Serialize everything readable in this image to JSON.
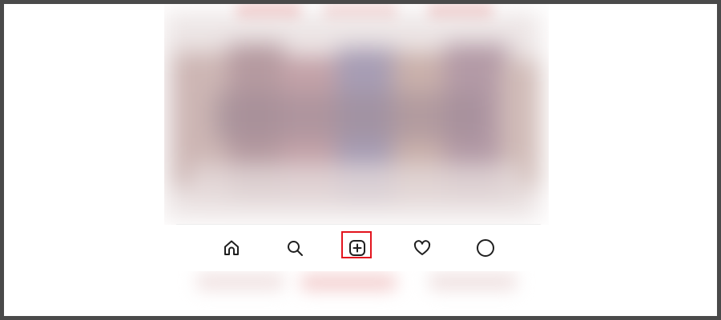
{
  "screen": {
    "frame_color": "#4a4a4a",
    "background": "#ffffff"
  },
  "feed": {
    "state": "blurred",
    "palette": [
      "#d8c8c8",
      "#b89aa0",
      "#c9a6a8",
      "#a89fb6",
      "#cdb7b0",
      "#e8dede",
      "#9e8f9c",
      "#d4b9b4"
    ],
    "accent_strip": "#f2b7b7"
  },
  "bottom_nav": {
    "items": [
      {
        "name": "home",
        "icon": "home-icon"
      },
      {
        "name": "search",
        "icon": "search-icon"
      },
      {
        "name": "new-post",
        "icon": "plus-square-icon",
        "highlighted": true
      },
      {
        "name": "activity",
        "icon": "heart-icon"
      },
      {
        "name": "profile",
        "icon": "profile-circle-icon"
      }
    ],
    "highlight_color": "#e3141e",
    "icon_color": "#1f1f1f"
  }
}
